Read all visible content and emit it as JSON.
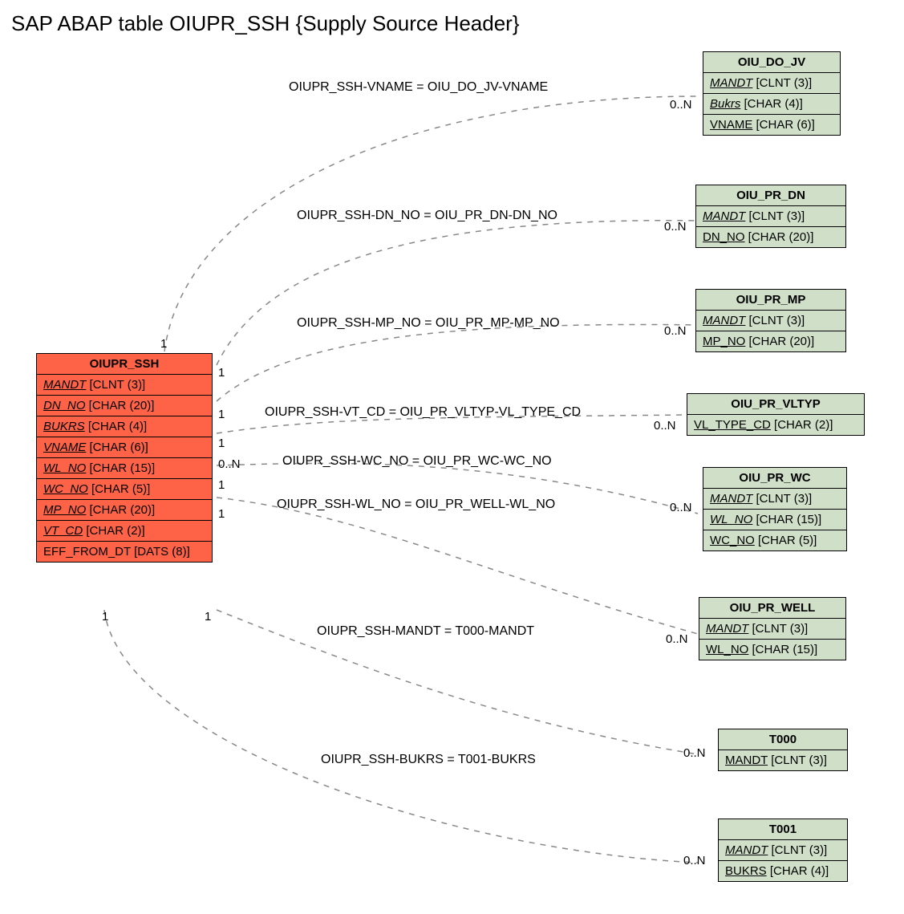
{
  "title": "SAP ABAP table OIUPR_SSH {Supply Source Header}",
  "main": {
    "name": "OIUPR_SSH",
    "fields": [
      {
        "name": "MANDT",
        "type": "[CLNT (3)]",
        "key": true
      },
      {
        "name": "DN_NO",
        "type": "[CHAR (20)]",
        "key": true
      },
      {
        "name": "BUKRS",
        "type": "[CHAR (4)]",
        "key": true
      },
      {
        "name": "VNAME",
        "type": "[CHAR (6)]",
        "key": true
      },
      {
        "name": "WL_NO",
        "type": "[CHAR (15)]",
        "key": true
      },
      {
        "name": "WC_NO",
        "type": "[CHAR (5)]",
        "key": true
      },
      {
        "name": "MP_NO",
        "type": "[CHAR (20)]",
        "key": true
      },
      {
        "name": "VT_CD",
        "type": "[CHAR (2)]",
        "key": true
      },
      {
        "name": "EFF_FROM_DT",
        "type": "[DATS (8)]",
        "key": false
      }
    ]
  },
  "related": [
    {
      "name": "OIU_DO_JV",
      "fields": [
        {
          "name": "MANDT",
          "type": "[CLNT (3)]",
          "key": true
        },
        {
          "name": "Bukrs",
          "type": "[CHAR (4)]",
          "key": false,
          "italic": true,
          "underline": true
        },
        {
          "name": "VNAME",
          "type": "[CHAR (6)]",
          "key": false,
          "underline": true
        }
      ]
    },
    {
      "name": "OIU_PR_DN",
      "fields": [
        {
          "name": "MANDT",
          "type": "[CLNT (3)]",
          "key": true
        },
        {
          "name": "DN_NO",
          "type": "[CHAR (20)]",
          "key": false,
          "underline": true
        }
      ]
    },
    {
      "name": "OIU_PR_MP",
      "fields": [
        {
          "name": "MANDT",
          "type": "[CLNT (3)]",
          "key": true
        },
        {
          "name": "MP_NO",
          "type": "[CHAR (20)]",
          "key": false,
          "underline": true
        }
      ]
    },
    {
      "name": "OIU_PR_VLTYP",
      "fields": [
        {
          "name": "VL_TYPE_CD",
          "type": "[CHAR (2)]",
          "key": false,
          "underline": true
        }
      ]
    },
    {
      "name": "OIU_PR_WC",
      "fields": [
        {
          "name": "MANDT",
          "type": "[CLNT (3)]",
          "key": true
        },
        {
          "name": "WL_NO",
          "type": "[CHAR (15)]",
          "key": false,
          "italic": true,
          "underline": true
        },
        {
          "name": "WC_NO",
          "type": "[CHAR (5)]",
          "key": false,
          "underline": true
        }
      ]
    },
    {
      "name": "OIU_PR_WELL",
      "fields": [
        {
          "name": "MANDT",
          "type": "[CLNT (3)]",
          "key": true
        },
        {
          "name": "WL_NO",
          "type": "[CHAR (15)]",
          "key": false,
          "underline": true
        }
      ]
    },
    {
      "name": "T000",
      "fields": [
        {
          "name": "MANDT",
          "type": "[CLNT (3)]",
          "key": false,
          "underline": true
        }
      ]
    },
    {
      "name": "T001",
      "fields": [
        {
          "name": "MANDT",
          "type": "[CLNT (3)]",
          "key": true
        },
        {
          "name": "BUKRS",
          "type": "[CHAR (4)]",
          "key": false,
          "underline": true
        }
      ]
    }
  ],
  "edges": [
    {
      "label": "OIUPR_SSH-VNAME = OIU_DO_JV-VNAME",
      "srcCard": "1",
      "dstCard": "0..N"
    },
    {
      "label": "OIUPR_SSH-DN_NO = OIU_PR_DN-DN_NO",
      "srcCard": "1",
      "dstCard": "0..N"
    },
    {
      "label": "OIUPR_SSH-MP_NO = OIU_PR_MP-MP_NO",
      "srcCard": "1",
      "dstCard": "0..N"
    },
    {
      "label": "OIUPR_SSH-VT_CD = OIU_PR_VLTYP-VL_TYPE_CD",
      "srcCard": "1",
      "dstCard": "0..N"
    },
    {
      "label": "OIUPR_SSH-WC_NO = OIU_PR_WC-WC_NO",
      "srcCard": "0..N",
      "dstCard": "0..N"
    },
    {
      "label": "OIUPR_SSH-WL_NO = OIU_PR_WELL-WL_NO",
      "srcCard": "1",
      "dstCard": "0..N"
    },
    {
      "label": "OIUPR_SSH-MANDT = T000-MANDT",
      "srcCard": "1",
      "dstCard": "0..N"
    },
    {
      "label": "OIUPR_SSH-BUKRS = T001-BUKRS",
      "srcCard": "1",
      "dstCard": "0..N"
    }
  ]
}
